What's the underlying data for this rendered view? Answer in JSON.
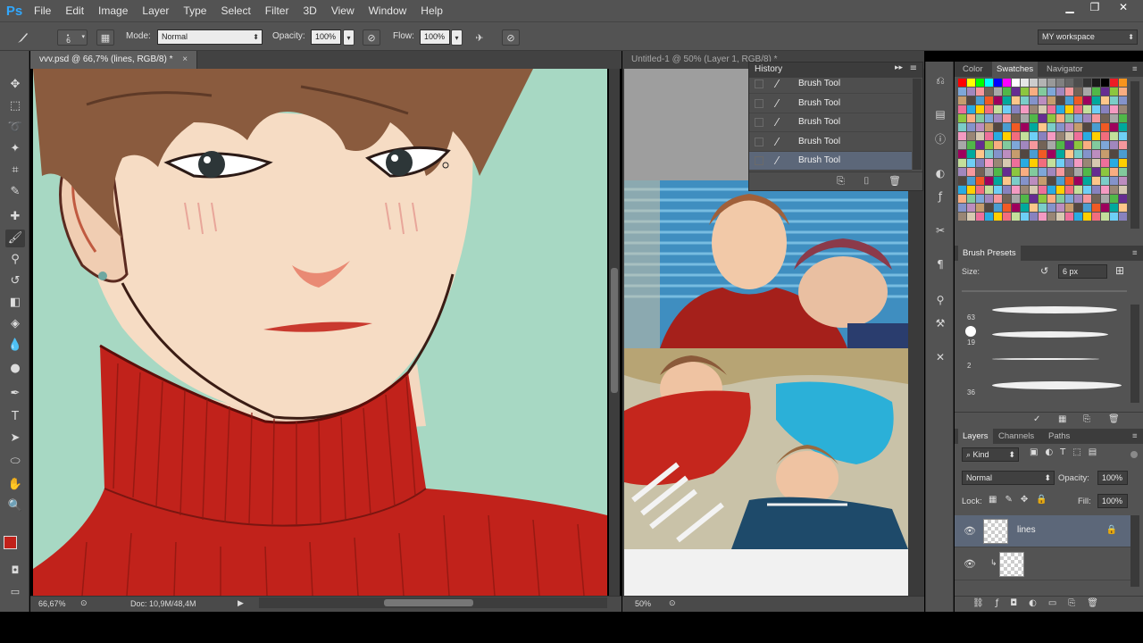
{
  "app": {
    "logo": "Ps",
    "menu": [
      "File",
      "Edit",
      "Image",
      "Layer",
      "Type",
      "Select",
      "Filter",
      "3D",
      "View",
      "Window",
      "Help"
    ],
    "window_controls": [
      "minimize-icon",
      "restore-icon",
      "close-icon"
    ]
  },
  "options": {
    "brush_size": "6",
    "mode_label": "Mode:",
    "mode_value": "Normal",
    "opacity_label": "Opacity:",
    "opacity_value": "100%",
    "flow_label": "Flow:",
    "flow_value": "100%",
    "workspace": "MY workspace"
  },
  "documents": {
    "tab1": "vvv.psd @ 66,7% (lines, RGB/8) *",
    "tab1_close": "×",
    "tab2": "Untitled-1 @ 50% (Layer 1, RGB/8) *"
  },
  "status1": {
    "zoom": "66,67%",
    "doc": "Doc: 10,9M/48,4M"
  },
  "status2": {
    "zoom": "50%"
  },
  "history": {
    "title": "History",
    "items": [
      "Brush Tool",
      "Brush Tool",
      "Brush Tool",
      "Brush Tool",
      "Brush Tool"
    ],
    "selected_index": 4
  },
  "swatches_panel": {
    "tabs": [
      "Color",
      "Swatches",
      "Navigator"
    ],
    "active_tab": "Swatches",
    "palette": [
      "#ff0000",
      "#ffff00",
      "#00ff00",
      "#00ffff",
      "#0000ff",
      "#ff00ff",
      "#ffffff",
      "#e6e6e6",
      "#cccccc",
      "#b3b3b3",
      "#999999",
      "#808080",
      "#666666",
      "#4d4d4d",
      "#333333",
      "#1a1a1a",
      "#000000",
      "#ed1c24",
      "#f7941d"
    ]
  },
  "brush_presets": {
    "title": "Brush Presets",
    "size_label": "Size:",
    "size_value": "6 px",
    "presets": [
      {
        "num": "63"
      },
      {
        "num": "19"
      },
      {
        "num": "2"
      },
      {
        "num": "36"
      }
    ]
  },
  "layers": {
    "tabs": [
      "Layers",
      "Channels",
      "Paths"
    ],
    "active_tab": "Layers",
    "kind": "Kind",
    "blend_mode": "Normal",
    "opacity_label": "Opacity:",
    "opacity_value": "100%",
    "lock_label": "Lock:",
    "fill_label": "Fill:",
    "fill_value": "100%",
    "items": [
      {
        "name": "lines",
        "selected": true
      },
      {
        "name": "",
        "selected": false
      }
    ]
  },
  "colors": {
    "foreground": "#c1211a",
    "background": "#000000",
    "canvas_bg": "#a7d8c3",
    "sweater": "#c1221b",
    "skin": "#f6dcc4",
    "hair": "#8a5b3e"
  }
}
